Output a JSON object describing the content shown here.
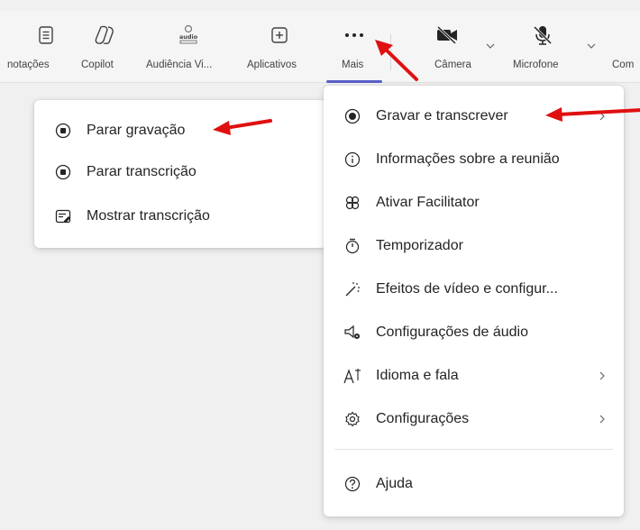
{
  "toolbar": {
    "items": [
      {
        "label": "notações",
        "icon": "notes-icon"
      },
      {
        "label": "Copilot",
        "icon": "copilot-icon"
      },
      {
        "label": "Audiência Vi...",
        "icon": "audience-view-icon"
      },
      {
        "label": "Aplicativos",
        "icon": "add-apps-icon"
      },
      {
        "label": "Mais",
        "icon": "more-horizontal-icon"
      },
      {
        "label": "Câmera",
        "icon": "camera-off-icon"
      },
      {
        "label": "Microfone",
        "icon": "mic-off-icon"
      },
      {
        "label": "Com",
        "icon": "share-content-icon"
      }
    ],
    "icon_audience_text": "audio",
    "accent": "#5b5fc7"
  },
  "submenu": {
    "items": [
      {
        "label": "Parar gravação",
        "icon": "stop-recording-icon"
      },
      {
        "label": "Parar transcrição",
        "icon": "stop-transcription-icon"
      },
      {
        "label": "Mostrar transcrição",
        "icon": "show-transcript-icon"
      }
    ]
  },
  "more_menu": {
    "items": [
      {
        "label": "Gravar e transcrever",
        "icon": "record-icon",
        "has_submenu": true
      },
      {
        "label": "Informações sobre a reunião",
        "icon": "info-icon",
        "has_submenu": false
      },
      {
        "label": "Ativar Facilitator",
        "icon": "facilitator-icon",
        "has_submenu": false
      },
      {
        "label": "Temporizador",
        "icon": "timer-icon",
        "has_submenu": false
      },
      {
        "label": "Efeitos de vídeo e configur...",
        "icon": "video-effects-icon",
        "has_submenu": false
      },
      {
        "label": "Configurações de áudio",
        "icon": "audio-settings-icon",
        "has_submenu": false
      },
      {
        "label": "Idioma e fala",
        "icon": "language-icon",
        "has_submenu": true
      },
      {
        "label": "Configurações",
        "icon": "settings-gear-icon",
        "has_submenu": true
      },
      {
        "label": "Ajuda",
        "icon": "help-icon",
        "has_submenu": false
      }
    ]
  },
  "annotation_color": "#e01010"
}
